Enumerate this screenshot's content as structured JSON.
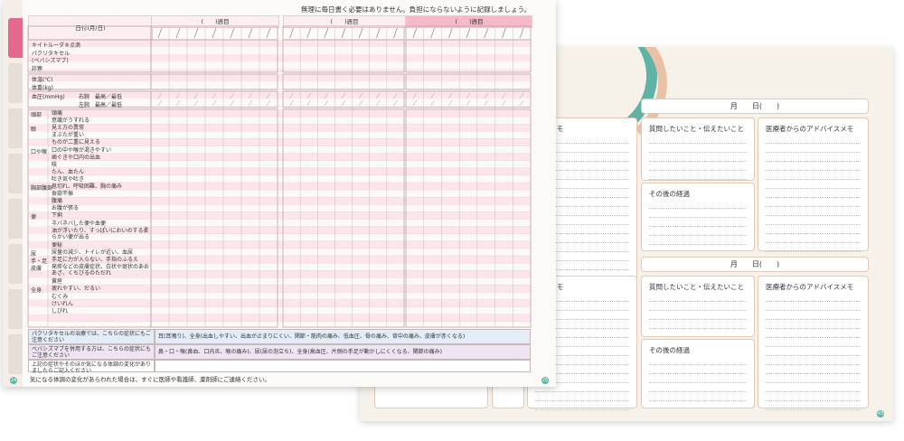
{
  "front_page": {
    "top_note": "無理に毎日書く必要はありません。負担にならないように記録しましょう。",
    "date_header": "日付(月/日)",
    "week_label": "(　　)週目",
    "date_slash": "／",
    "meds": [
      "キイトルーダ®点滴",
      "パクリタキセル",
      "(ベバシズマブ)",
      "診察"
    ],
    "vitals": [
      "体温(℃)",
      "体重(kg)"
    ],
    "bp_label": "血圧(mmHg)",
    "bp_rows": [
      "右腕　最高／最低",
      "左腕　最高／最低"
    ],
    "symptom_categories": [
      {
        "name": "頭部",
        "items": [
          "頭痛",
          "意識がうすれる"
        ]
      },
      {
        "name": "眼",
        "items": [
          "見え方の異常",
          "まぶたが重い",
          "ものが二重に見える"
        ]
      },
      {
        "name": "口や喉",
        "items": [
          "口の中や喉が渇きやすい",
          "歯ぐきや口内の出血",
          "咳",
          "たん、血たん",
          "吐き気や吐き"
        ]
      },
      {
        "name": "胸部腹部",
        "items": [
          "息切れ、呼吸困難、胸の痛み",
          "食欲不振",
          "腹痛",
          "お腹が張る"
        ]
      },
      {
        "name": "便",
        "items": [
          "下痢",
          "ネバネバした便や血便",
          "油が浮いたり、すっぱいにおいのする柔らかい便が出る",
          "便秘"
        ]
      },
      {
        "name": "尿",
        "items": [
          "尿量の減少、トイレが近い、血尿"
        ]
      },
      {
        "name": "手・足",
        "items": [
          "手足に力が入らない、手指のふるえ"
        ]
      },
      {
        "name": "皮膚",
        "items": [
          "発疹などの皮膚症状、白状や斑状のあおあざ、くちびるのただれ"
        ]
      },
      {
        "name": "",
        "items": [
          "黄疸"
        ]
      },
      {
        "name": "全身",
        "items": [
          "疲れやすい、だるい",
          "むくみ",
          "けいれん",
          "しびれ"
        ]
      }
    ],
    "notes": [
      {
        "label": "パクリタキセルの治療では、こちらの症状にもご注意ください",
        "text": "耳(耳鳴り)、全身(出血しやすい、出血が止まりにくい、関節・筋肉の痛み、低血圧、骨の痛み、背中の痛み、皮膚が赤くなる)"
      },
      {
        "label": "ベバシズマブを併用する方は、こちらの症状にもご注意ください",
        "text": "鼻・口・喉(鼻血、口内炎、喉の痛み)、尿(尿の泡立ち)、全身(高血圧、片側の手足が動かしにくくなる、関節の痛み)"
      },
      {
        "label": "上記の症状やそのほか気になる体調の変化がありましたらご記入ください",
        "text": ""
      }
    ],
    "footnote": "気になる体調の変化があらわれた場合は、すぐに医師や看護師、薬剤師にご連絡ください。",
    "page_left": "24",
    "page_right": "25"
  },
  "back_page": {
    "date_label": "月　　日(　　)",
    "question_title": "質問したいこと・伝えたいこと",
    "advice_title": "医療者からのアドバイスメモ",
    "advice_title_cut": "バイスメモ",
    "followup_title": "その後の経過",
    "page_num": "43"
  },
  "colors": {
    "pink": "#f6b9c8",
    "teal": "#5fb3a6",
    "peach": "#e9c2a6"
  }
}
